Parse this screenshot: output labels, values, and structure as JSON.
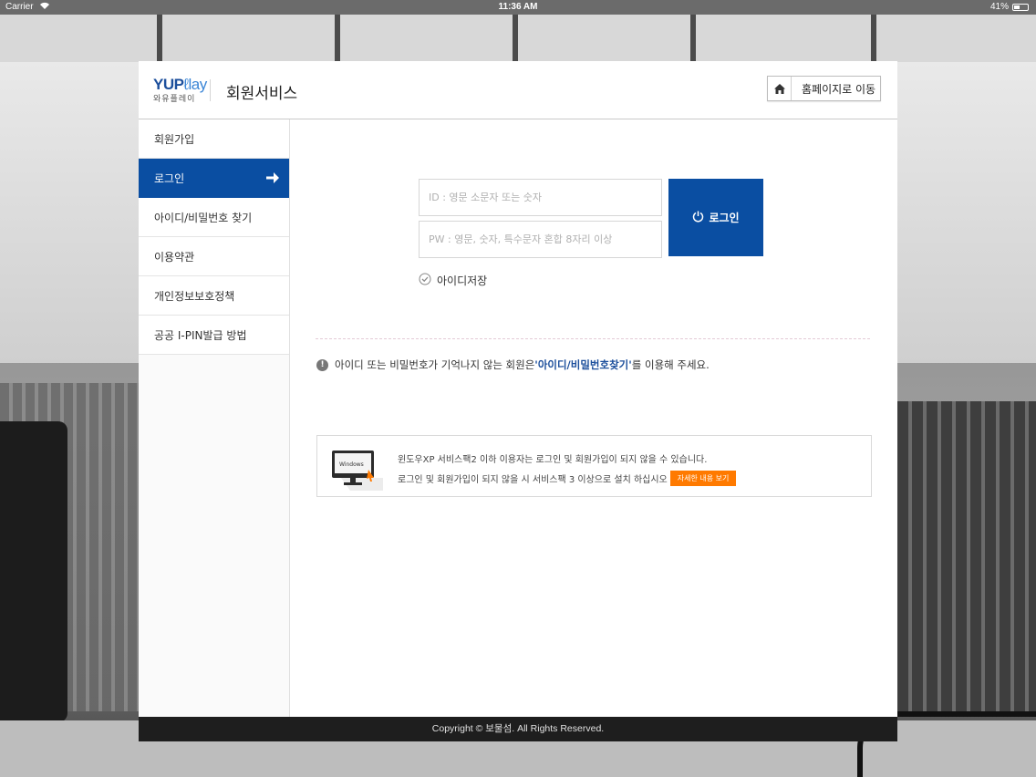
{
  "status_bar": {
    "carrier": "Carrier",
    "time": "11:36 AM",
    "battery": "41%"
  },
  "header": {
    "logo_main": "YUP",
    "logo_play": "lay",
    "logo_sub": "와유플레이",
    "title": "회원서비스",
    "home_button": "홈페이지로 이동"
  },
  "sidebar": {
    "items": [
      {
        "label": "회원가입",
        "active": false
      },
      {
        "label": "로그인",
        "active": true
      },
      {
        "label": "아이디/비밀번호 찾기",
        "active": false
      },
      {
        "label": "이용약관",
        "active": false
      },
      {
        "label": "개인정보보호정책",
        "active": false
      },
      {
        "label": "공공 I-PIN발급 방법",
        "active": false
      }
    ]
  },
  "login": {
    "id_placeholder": "ID : 영문 소문자 또는 숫자",
    "pw_placeholder": "PW : 영문, 숫자, 특수문자 혼합 8자리 이상",
    "login_button": "로그인",
    "remember_label": "아이디저장"
  },
  "notice": {
    "prefix": "아이디 또는 비밀번호가 기억나지 않는 회원은",
    "highlight": "'아이디/비밀번호찾기'",
    "suffix": "를 이용해 주세요."
  },
  "xp_notice": {
    "line1": "윈도우XP 서비스팩2 이하 이용자는 로그인 및 회원가입이 되지 않을 수 있습니다.",
    "line2": "로그인 및 회원가입이 되지 않을 시 서비스팩 3 이상으로 설치 하십시오",
    "detail_button": "자세한 내용 보기",
    "monitor_label": "Windows"
  },
  "footer": {
    "copyright": "Copyright © 보물섬. All Rights Reserved."
  },
  "colors": {
    "primary": "#0a4ea2",
    "accent": "#ff7a00",
    "footer_bg": "#1e1e1e"
  }
}
